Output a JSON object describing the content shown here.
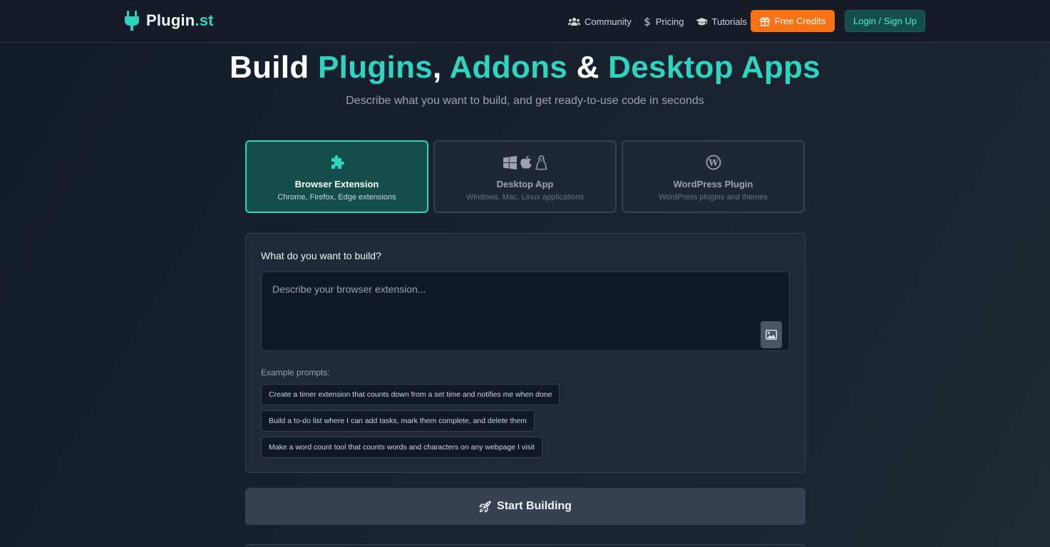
{
  "brand": {
    "name_main": "Plugin",
    "name_accent": ".st"
  },
  "nav": {
    "community": "Community",
    "pricing": "Pricing",
    "tutorials": "Tutorials",
    "free_credits": "Free Credits",
    "login": "Login / Sign Up"
  },
  "hero": {
    "title_build": "Build",
    "title_plugins": "Plugins",
    "title_comma": ",",
    "title_addons": "Addons",
    "title_amp": "&",
    "title_desktop": "Desktop Apps",
    "subtitle": "Describe what you want to build, and get ready-to-use code in seconds"
  },
  "types": [
    {
      "title": "Browser Extension",
      "desc": "Chrome, Firefox, Edge extensions",
      "icon": "puzzle-icon"
    },
    {
      "title": "Desktop App",
      "desc": "Windows, Mac, Linux applications",
      "icon": "windows-apple-linux-icons"
    },
    {
      "title": "WordPress Plugin",
      "desc": "WordPress plugins and themes",
      "icon": "wordpress-icon"
    }
  ],
  "build": {
    "label": "What do you want to build?",
    "placeholder": "Describe your browser extension...",
    "examples_label": "Example prompts:",
    "examples": [
      "Create a timer extension that counts down from a set time and notifies me when done",
      "Build a to-do list where I can add tasks, mark them complete, and delete them",
      "Make a word count tool that counts words and characters on any webpage I visit"
    ]
  },
  "start": {
    "label": "Start Building"
  },
  "colors": {
    "accent": "#2dd4bf",
    "credits": "#f97316",
    "background": "#1a2230"
  }
}
